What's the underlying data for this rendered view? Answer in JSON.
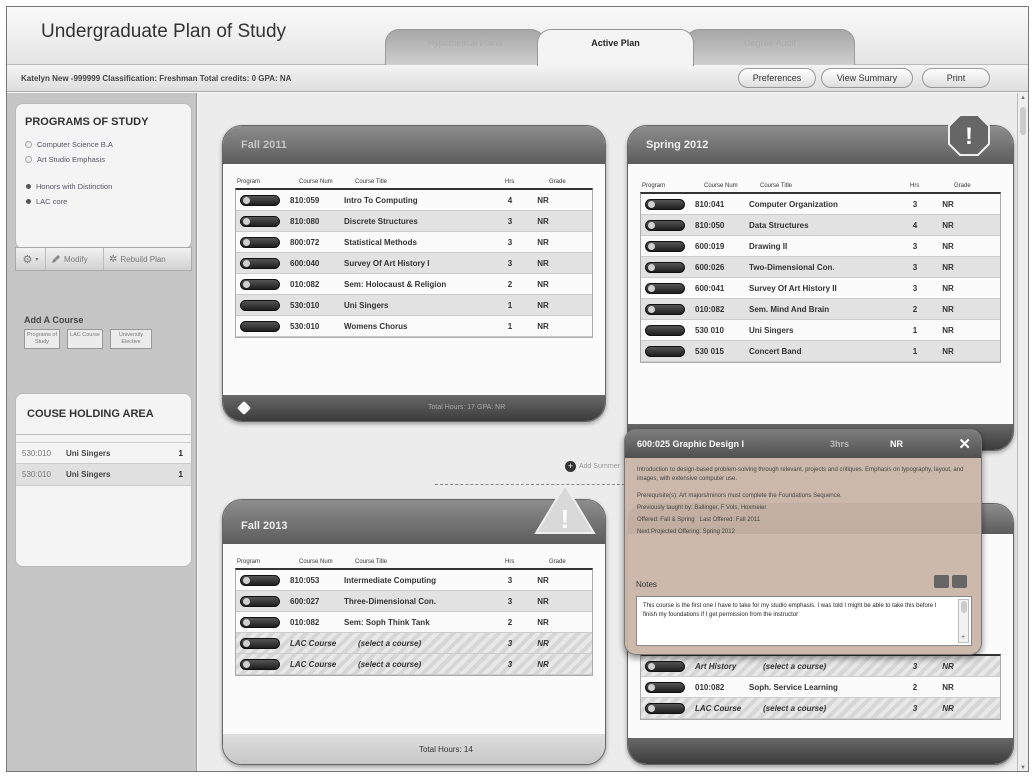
{
  "app": {
    "title": "Undergraduate Plan of Study"
  },
  "tabs": [
    {
      "label": "Hypothetical Plans",
      "active": false
    },
    {
      "label": "Active Plan",
      "active": true
    },
    {
      "label": "Degree Audit",
      "active": false
    }
  ],
  "student": {
    "info": "Katelyn New -999999  Classification: Freshman  Total credits: 0  GPA: NA"
  },
  "header_buttons": {
    "preferences": "Preferences",
    "view_summary": "View Summary",
    "print": "Print"
  },
  "sidebar": {
    "programs_heading": "PROGRAMS OF STUDY",
    "programs": [
      "Computer Science B.A",
      "Art Studio Emphasis",
      "Honors with Distinction",
      "LAC core"
    ],
    "toolbar": {
      "gear": "⚙",
      "modify": "Modify",
      "rebuild": "Rebuild Plan"
    },
    "add_course": {
      "title": "Add A Course",
      "buttons": [
        "Programs of Study",
        "LAC Course",
        "University Elective"
      ]
    },
    "holding_heading": "COUSE HOLDING AREA",
    "holding": [
      {
        "num": "530:010",
        "title": "Uni Singers",
        "hrs": "1"
      },
      {
        "num": "530:010",
        "title": "Uni Singers",
        "hrs": "1"
      }
    ]
  },
  "columns": {
    "program": "Program",
    "course_num": "Course Num",
    "course_title": "Course Title",
    "hrs": "Hrs",
    "grade": "Grade"
  },
  "semesters": {
    "fall2011": {
      "title": "Fall 2011",
      "totals": "Total Hours: 17  GPA: NR",
      "rows": [
        {
          "num": "810:059",
          "title": "Intro To Computing",
          "hrs": "4",
          "grade": "NR"
        },
        {
          "num": "810:080",
          "title": "Discrete Structures",
          "hrs": "3",
          "grade": "NR"
        },
        {
          "num": "800:072",
          "title": "Statistical Methods",
          "hrs": "3",
          "grade": "NR"
        },
        {
          "num": "600:040",
          "title": "Survey Of Art History I",
          "hrs": "3",
          "grade": "NR"
        },
        {
          "num": "010:082",
          "title": "Sem: Holocaust & Religion",
          "hrs": "2",
          "grade": "NR"
        },
        {
          "num": "530:010",
          "title": "Uni Singers",
          "hrs": "1",
          "grade": "NR"
        },
        {
          "num": "530:010",
          "title": "Womens Chorus",
          "hrs": "1",
          "grade": "NR"
        }
      ]
    },
    "spring2012": {
      "title": "Spring 2012",
      "rows": [
        {
          "num": "810:041",
          "title": "Computer Organization",
          "hrs": "3",
          "grade": "NR"
        },
        {
          "num": "810:050",
          "title": "Data Structures",
          "hrs": "4",
          "grade": "NR"
        },
        {
          "num": "600:019",
          "title": "Drawing II",
          "hrs": "3",
          "grade": "NR"
        },
        {
          "num": "600:026",
          "title": "Two-Dimensional Con.",
          "hrs": "3",
          "grade": "NR"
        },
        {
          "num": "600:041",
          "title": "Survey Of Art History II",
          "hrs": "3",
          "grade": "NR"
        },
        {
          "num": "010:082",
          "title": "Sem. Mind And Brain",
          "hrs": "2",
          "grade": "NR"
        },
        {
          "num": "530 010",
          "title": "Uni Singers",
          "hrs": "1",
          "grade": "NR"
        },
        {
          "num": "530 015",
          "title": "Concert Band",
          "hrs": "1",
          "grade": "NR"
        }
      ]
    },
    "fall2013": {
      "title": "Fall 2013",
      "totals": "Total Hours: 14",
      "rows": [
        {
          "num": "810:053",
          "title": "Intermediate Computing",
          "hrs": "3",
          "grade": "NR"
        },
        {
          "num": "600:027",
          "title": "Three-Dimensional Con.",
          "hrs": "3",
          "grade": "NR"
        },
        {
          "num": "010:082",
          "title": "Sem: Soph Think Tank",
          "hrs": "2",
          "grade": "NR"
        },
        {
          "num": "LAC Course",
          "title": "(select a course)",
          "hrs": "3",
          "grade": "NR"
        },
        {
          "num": "LAC Course",
          "title": "(select a course)",
          "hrs": "3",
          "grade": "NR"
        }
      ]
    },
    "spring2014": {
      "rows": [
        {
          "num": "Art History",
          "title": "(select a course)",
          "hrs": "3",
          "grade": "NR"
        },
        {
          "num": "010:082",
          "title": "Soph. Service Learning",
          "hrs": "2",
          "grade": "NR"
        },
        {
          "num": "LAC Course",
          "title": "(select a course)",
          "hrs": "3",
          "grade": "NR"
        }
      ]
    }
  },
  "add_summer": "Add Summer",
  "popup": {
    "title": "600:025 Graphic Design I",
    "hrs": "3hrs",
    "grade": "NR",
    "description": "Introduction to design-based problem-solving through relevant, projects and critiques. Emphasis on typography, layout, and images, with extensive computer use.",
    "prereq": "Prerequisite(s): Art majors/minors must complete the Foundations Sequence.",
    "taught_by": "Previously taught by: Ballinger, F Vols, Hoxmeier",
    "offered": "Offered: Fall & Spring",
    "last_offered": "Last Offered: Fall 2011",
    "next_offering": "Next Projected Offering: Spring 2012",
    "notes_label": "Notes",
    "notes": "This course is the first one I have to take for my studio emphasis. I was told I might be able to take this before I finish my foundations if I get permission from the instructor"
  },
  "icons": {
    "alert": "!",
    "close": "✕",
    "add_circle": "+"
  }
}
